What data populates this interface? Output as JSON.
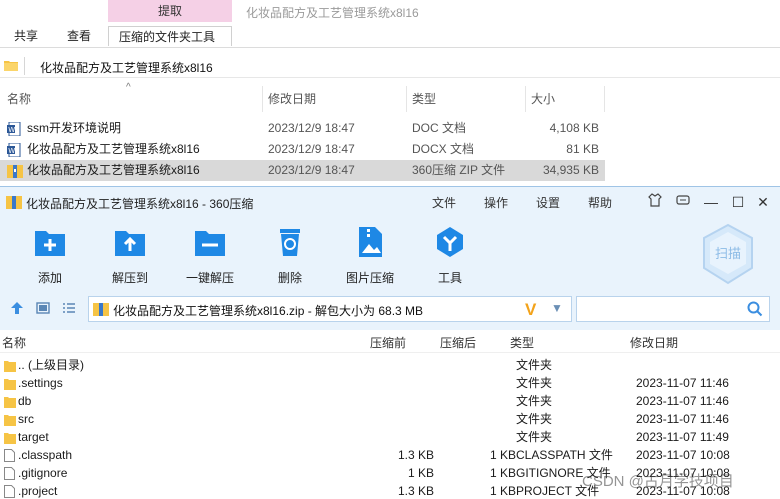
{
  "ribbon": {
    "context_tab_header": "提取",
    "context_tab": "压缩的文件夹工具",
    "tabs": [
      "共享",
      "查看"
    ],
    "window_title": "化妆品配方及工艺管理系统x8l16"
  },
  "address": {
    "path": "化妆品配方及工艺管理系统x8l16"
  },
  "explorer_columns": {
    "name": "名称",
    "date": "修改日期",
    "type": "类型",
    "size": "大小"
  },
  "explorer_files": [
    {
      "name": "ssm开发环境说明",
      "date": "2023/12/9 18:47",
      "type": "DOC 文档",
      "size": "4,108 KB",
      "icon": "word-doc-icon"
    },
    {
      "name": "化妆品配方及工艺管理系统x8l16",
      "date": "2023/12/9 18:47",
      "type": "DOCX 文档",
      "size": "81 KB",
      "icon": "word-doc-icon"
    },
    {
      "name": "化妆品配方及工艺管理系统x8l16",
      "date": "2023/12/9 18:47",
      "type": "360压缩 ZIP 文件",
      "size": "34,935 KB",
      "icon": "zip-archive-icon",
      "selected": true
    }
  ],
  "zip_window": {
    "title": "化妆品配方及工艺管理系统x8l16 - 360压缩",
    "menu": [
      "文件",
      "操作",
      "设置",
      "帮助"
    ],
    "tools": [
      "添加",
      "解压到",
      "一键解压",
      "删除",
      "图片压缩",
      "工具"
    ],
    "scan_label": "扫描",
    "path_text": "化妆品配方及工艺管理系统x8l16.zip - 解包大小为 68.3 MB",
    "columns": {
      "name": "名称",
      "compressed": "压缩前",
      "original": "压缩后",
      "type": "类型",
      "date": "修改日期"
    },
    "rows": [
      {
        "name": ".. (上级目录)",
        "compressed": "",
        "original": "",
        "type": "文件夹",
        "date": "",
        "kind": "folder"
      },
      {
        "name": ".settings",
        "compressed": "",
        "original": "",
        "type": "文件夹",
        "date": "2023-11-07 11:46",
        "kind": "folder"
      },
      {
        "name": "db",
        "compressed": "",
        "original": "",
        "type": "文件夹",
        "date": "2023-11-07 11:46",
        "kind": "folder"
      },
      {
        "name": "src",
        "compressed": "",
        "original": "",
        "type": "文件夹",
        "date": "2023-11-07 11:46",
        "kind": "folder"
      },
      {
        "name": "target",
        "compressed": "",
        "original": "",
        "type": "文件夹",
        "date": "2023-11-07 11:49",
        "kind": "folder"
      },
      {
        "name": ".classpath",
        "compressed": "1.3 KB",
        "original": "1 KB",
        "type": "CLASSPATH 文件",
        "date": "2023-11-07 10:08",
        "kind": "file"
      },
      {
        "name": ".gitignore",
        "compressed": "1 KB",
        "original": "1 KB",
        "type": "GITIGNORE 文件",
        "date": "2023-11-07 10:08",
        "kind": "file"
      },
      {
        "name": ".project",
        "compressed": "1.3 KB",
        "original": "1 KB",
        "type": "PROJECT 文件",
        "date": "2023-11-07 10:08",
        "kind": "file"
      }
    ]
  },
  "watermark": "CSDN @古月学技项目",
  "colors": {
    "accent_blue": "#1e88e5",
    "folder_yellow": "#f6c445",
    "context_pink": "#f5d0e6",
    "zip_bg": "#e9f3fc"
  }
}
